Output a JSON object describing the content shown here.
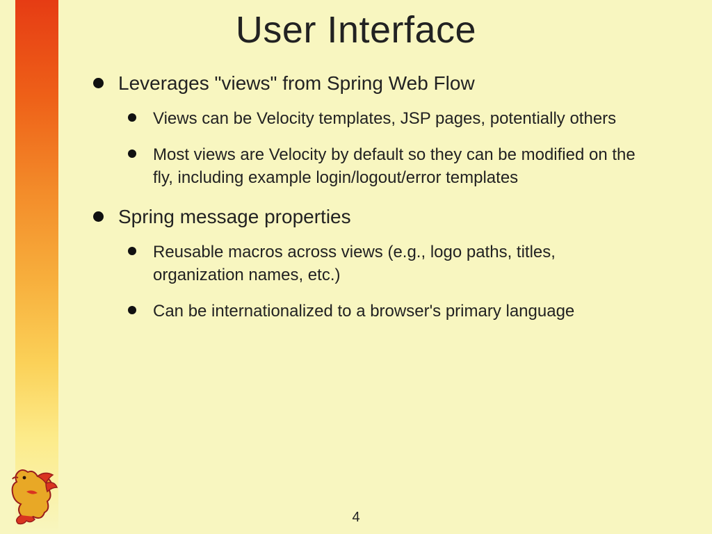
{
  "title": "User Interface",
  "bullets": [
    {
      "text": "Leverages \"views\" from Spring Web Flow",
      "children": [
        "Views can be Velocity templates, JSP pages, potentially others",
        "Most views are Velocity by default so they can be modified on the fly, including example login/logout/error templates"
      ]
    },
    {
      "text": "Spring message properties",
      "children": [
        "Reusable macros across views (e.g., logo paths, titles, organization names, etc.)",
        "Can be internationalized to a browser's primary language"
      ]
    }
  ],
  "page_number": "4"
}
